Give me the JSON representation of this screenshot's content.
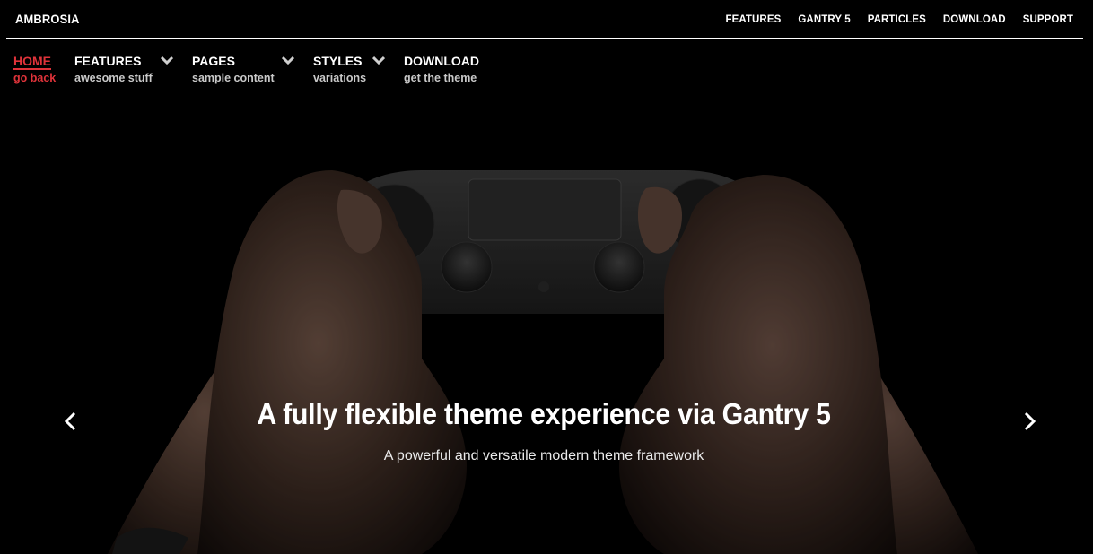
{
  "brand": "AMBROSIA",
  "top_nav": [
    "FEATURES",
    "GANTRY 5",
    "PARTICLES",
    "DOWNLOAD",
    "SUPPORT"
  ],
  "main_menu": [
    {
      "title": "HOME",
      "subtitle": "go back",
      "active": true,
      "has_dropdown": false
    },
    {
      "title": "FEATURES",
      "subtitle": "awesome stuff",
      "active": false,
      "has_dropdown": true
    },
    {
      "title": "PAGES",
      "subtitle": "sample content",
      "active": false,
      "has_dropdown": true
    },
    {
      "title": "STYLES",
      "subtitle": "variations",
      "active": false,
      "has_dropdown": true
    },
    {
      "title": "DOWNLOAD",
      "subtitle": "get the theme",
      "active": false,
      "has_dropdown": false
    }
  ],
  "hero": {
    "headline": "A fully flexible theme experience via Gantry 5",
    "subline": "A powerful and versatile modern theme framework",
    "prev_icon": "chevron-left-icon",
    "next_icon": "chevron-right-icon"
  },
  "colors": {
    "accent": "#e0333a",
    "background": "#000000",
    "text": "#ffffff"
  }
}
